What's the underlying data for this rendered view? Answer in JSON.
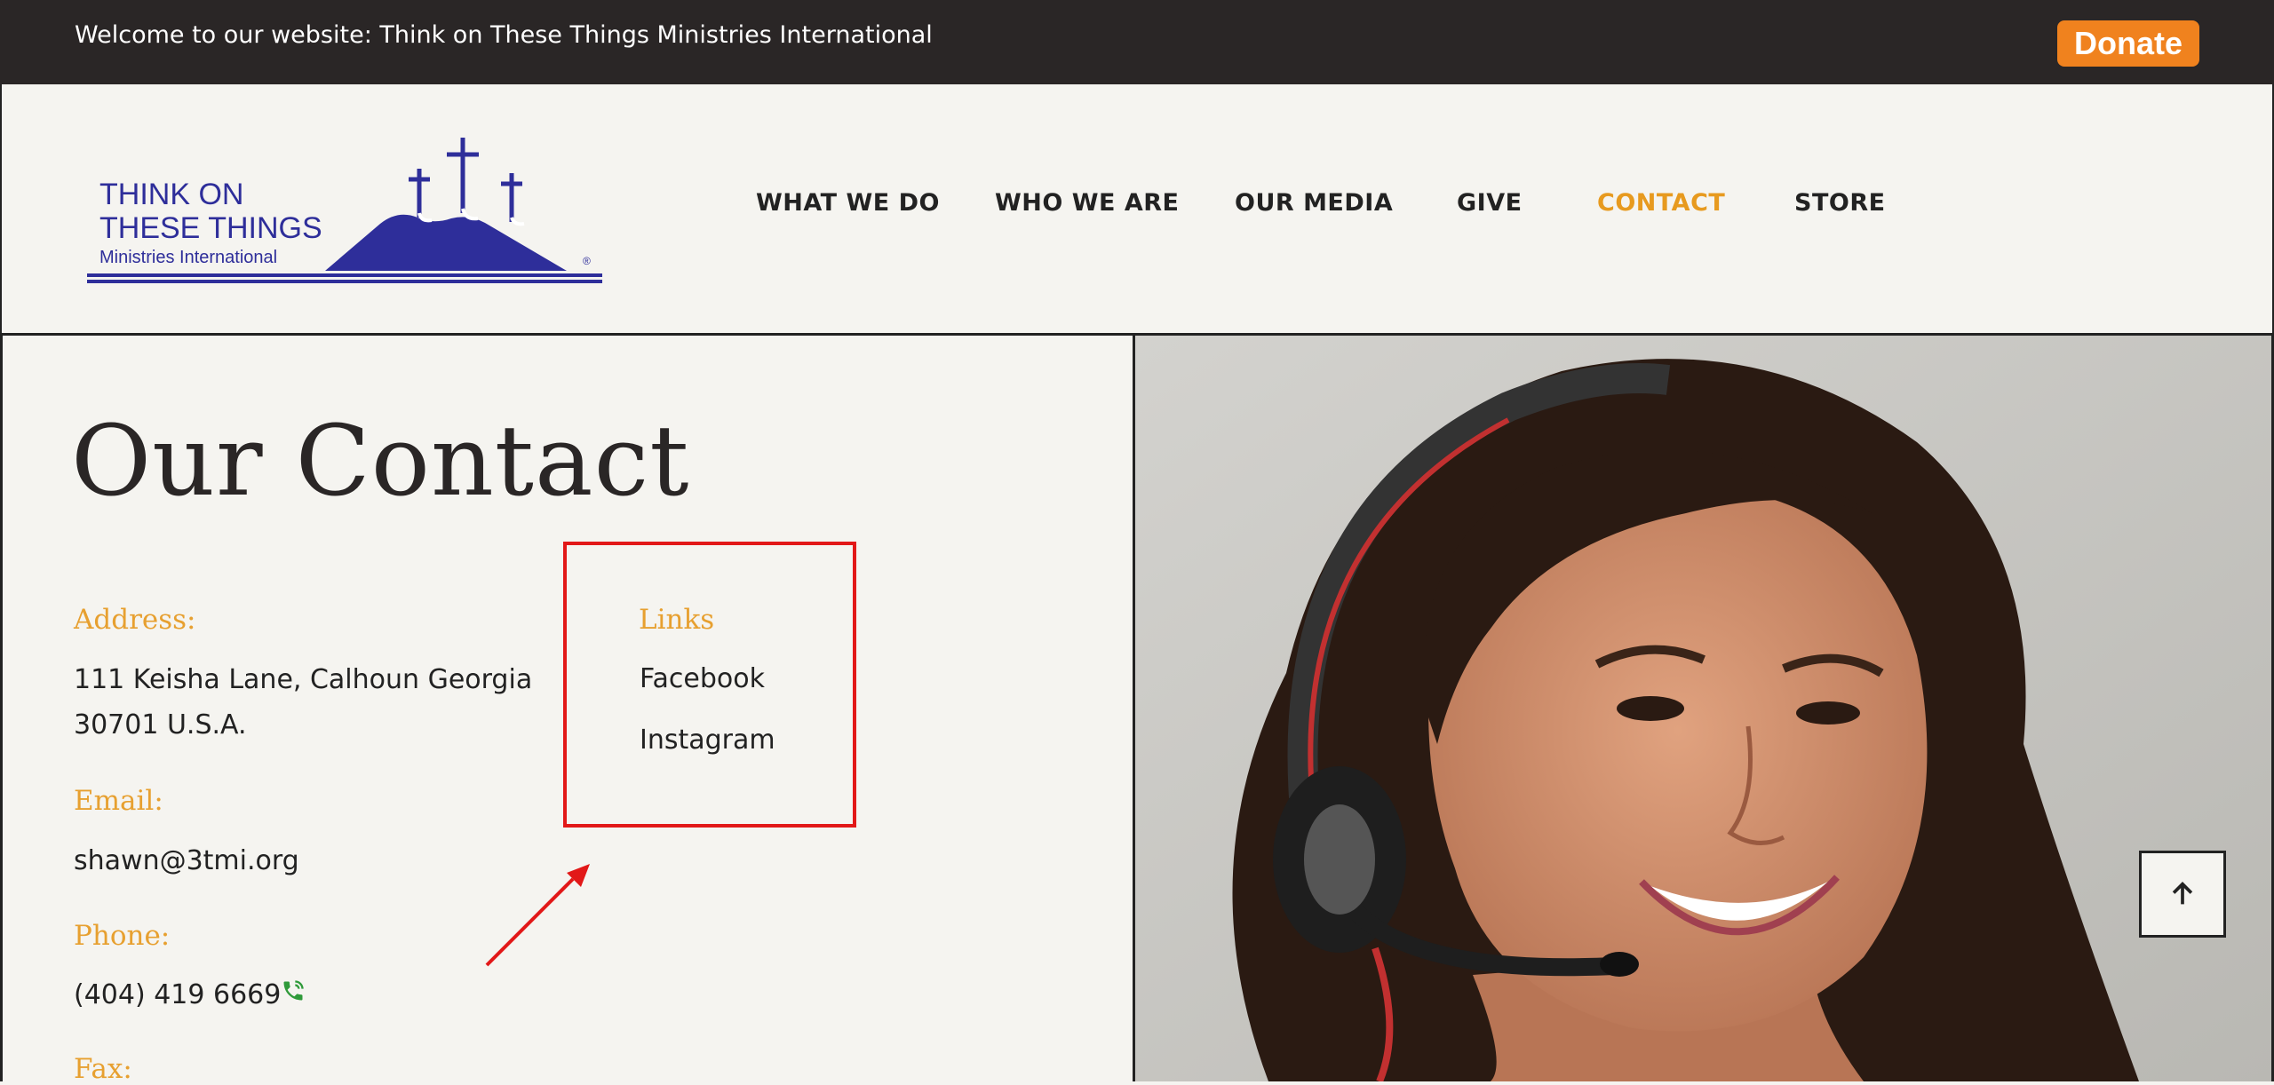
{
  "topbar": {
    "welcome": "Welcome to our website: Think on These Things Ministries International",
    "donate_label": "Donate"
  },
  "logo": {
    "line1": "THINK ON",
    "line2": "THESE THINGS",
    "line3": "Ministries International",
    "mark": "®"
  },
  "nav": {
    "items": [
      {
        "label": "WHAT WE DO"
      },
      {
        "label": "WHO WE ARE"
      },
      {
        "label": "OUR MEDIA"
      },
      {
        "label": "GIVE"
      },
      {
        "label": "CONTACT",
        "active": true
      },
      {
        "label": "STORE"
      }
    ]
  },
  "contact": {
    "title": "Our Contact",
    "address_label": "Address:",
    "address_line1": "111 Keisha Lane, Calhoun Georgia",
    "address_line2": "30701 U.S.A.",
    "email_label": "Email:",
    "email": "shawn@3tmi.org",
    "phone_label": "Phone:",
    "phone": "(404) 419 6669",
    "fax_label": "Fax:",
    "links_label": "Links",
    "links": [
      "Facebook",
      "Instagram"
    ]
  },
  "colors": {
    "accent": "#e79a1f",
    "donate": "#f0821e",
    "logo_blue": "#2e2e9a",
    "highlight": "#e21818"
  },
  "icons": {
    "phone": "phone-icon",
    "scroll_top": "arrow-up-icon"
  }
}
